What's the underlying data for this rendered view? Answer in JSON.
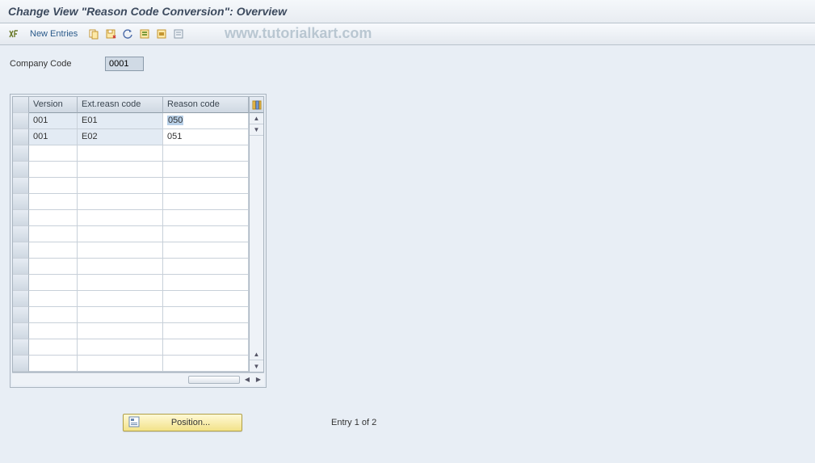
{
  "title": "Change View \"Reason Code Conversion\": Overview",
  "watermark": "www.tutorialkart.com",
  "toolbar": {
    "new_entries": "New Entries"
  },
  "fields": {
    "company_code_label": "Company Code",
    "company_code_value": "0001"
  },
  "table": {
    "headers": {
      "version": "Version",
      "ext_reason": "Ext.reasn code",
      "reason": "Reason code"
    },
    "rows": [
      {
        "version": "001",
        "ext": "E01",
        "reason": "050"
      },
      {
        "version": "001",
        "ext": "E02",
        "reason": "051"
      }
    ],
    "empty_row_count": 14
  },
  "footer": {
    "position_label": "Position...",
    "entry_text": "Entry 1 of 2"
  }
}
